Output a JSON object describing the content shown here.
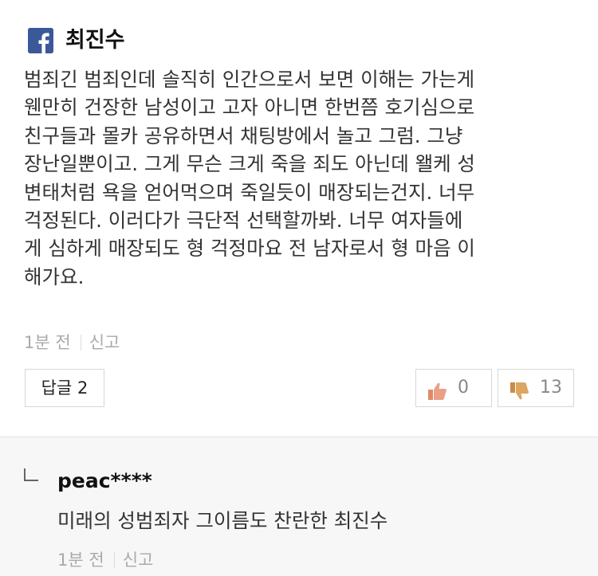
{
  "comment": {
    "source_icon": "facebook-icon",
    "author": "최진수",
    "lines": [
      "범죄긴 범죄인데 솔직히 인간으로서 보면 이해는 가는게",
      "웬만히 건장한 남성이고 고자 아니면 한번쯤 호기심으로",
      "친구들과 몰카 공유하면서 채팅방에서 놀고 그럼. 그냥",
      "장난일뿐이고. 그게 무슨 크게 죽을 죄도 아닌데 왤케 성",
      "변태처럼 욕을 얻어먹으며 죽일듯이 매장되는건지. 너무",
      "걱정된다. 이러다가 극단적 선택할까봐. 너무 여자들에",
      "게 심하게 매장되도 형 걱정마요 전 남자로서 형 마음 이",
      "해가요."
    ],
    "time": "1분 전",
    "report_label": "신고",
    "reply_button_label": "답글 2",
    "like_count": "0",
    "dislike_count": "13",
    "like_icon": "thumbs-up-icon",
    "dislike_icon": "thumbs-down-icon"
  },
  "reply": {
    "icon": "reply-arrow-icon",
    "author": "peac****",
    "text": "미래의 성범죄자 그이름도 찬란한 최진수",
    "time": "1분 전",
    "report_label": "신고"
  },
  "colors": {
    "facebook_blue": "#3b5998",
    "like_thumb": "#e08a6a",
    "dislike_thumb": "#d79a55"
  }
}
